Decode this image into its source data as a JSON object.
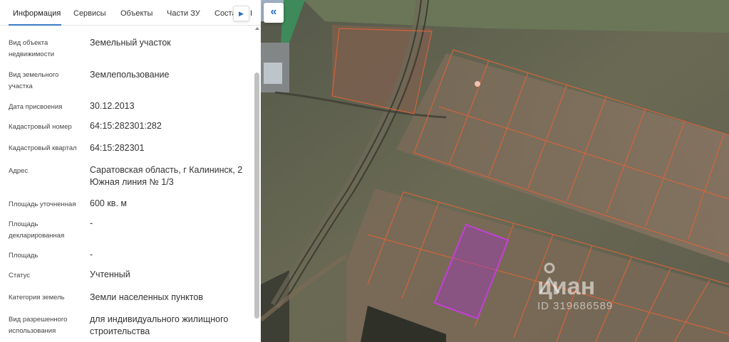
{
  "tabs": [
    {
      "label": "Информация"
    },
    {
      "label": "Сервисы"
    },
    {
      "label": "Объекты"
    },
    {
      "label": "Части ЗУ"
    },
    {
      "label": "Соста"
    },
    {
      "label": "I"
    }
  ],
  "tab_scroll_icon": "▶",
  "collapse_icon": "«",
  "properties": [
    {
      "label_line1": "Вид объекта",
      "label_line2": "недвижимости",
      "value_line1": "Земельный участок",
      "value_line2": ""
    },
    {
      "label_line1": "Вид земельного",
      "label_line2": "участка",
      "value_line1": "Землепользование",
      "value_line2": ""
    },
    {
      "label_line1": "Дата присвоения",
      "label_line2": "",
      "value_line1": "30.12.2013",
      "value_line2": ""
    },
    {
      "label_line1": "Кадастровый номер",
      "label_line2": "",
      "value_line1": "64:15:282301:282",
      "value_line2": ""
    },
    {
      "label_line1": "Кадастровый квартал",
      "label_line2": "",
      "value_line1": "64:15:282301",
      "value_line2": ""
    },
    {
      "label_line1": "Адрес",
      "label_line2": "",
      "value_line1": "Саратовская область, г Калининск, 2",
      "value_line2": "Южная линия № 1/3"
    },
    {
      "label_line1": "Площадь уточненная",
      "label_line2": "",
      "value_line1": "600 кв. м",
      "value_line2": ""
    },
    {
      "label_line1": "Площадь",
      "label_line2": "декларированная",
      "value_line1": "-",
      "value_line2": ""
    },
    {
      "label_line1": "Площадь",
      "label_line2": "",
      "value_line1": "-",
      "value_line2": ""
    },
    {
      "label_line1": "Статус",
      "label_line2": "",
      "value_line1": "Учтенный",
      "value_line2": ""
    },
    {
      "label_line1": "Категория земель",
      "label_line2": "",
      "value_line1": "Земли населенных пунктов",
      "value_line2": ""
    },
    {
      "label_line1": "Вид разрешенного",
      "label_line2": "использования",
      "value_line1": "для индивидуального жилищного",
      "value_line2": "строительства"
    }
  ],
  "watermark": {
    "logo_text": "циан",
    "id_text": "ID 319686589"
  },
  "colors": {
    "accent": "#2b6fc4",
    "parcel_outline": "#d9643a",
    "selected_parcel": "#c23fd8"
  }
}
